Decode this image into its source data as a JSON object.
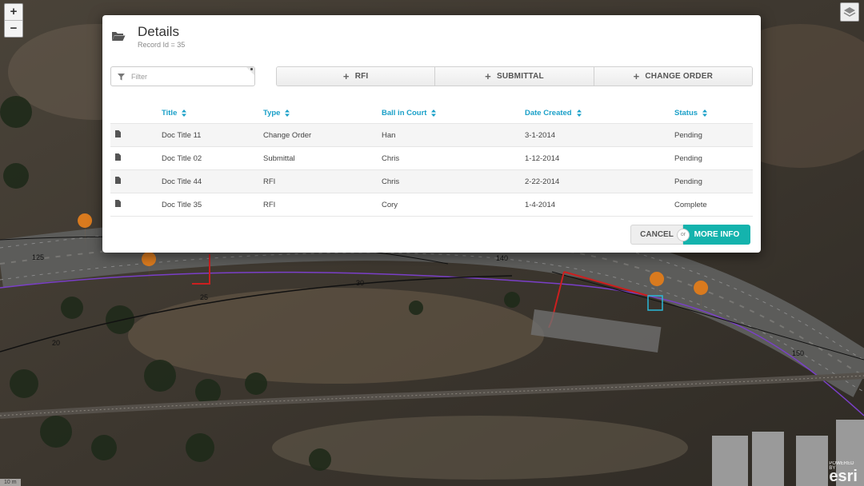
{
  "map": {
    "zoom_in": "+",
    "zoom_out": "−",
    "brand": "esri",
    "brand_small": "POWERED BY",
    "scale": "10 m"
  },
  "modal": {
    "title": "Details",
    "subtitle": "Record Id = 35",
    "filter_placeholder": "Filter",
    "actions": [
      {
        "label": "RFI",
        "icon": "plus-icon"
      },
      {
        "label": "SUBMITTAL",
        "icon": "plus-icon"
      },
      {
        "label": "CHANGE ORDER",
        "icon": "plus-icon"
      }
    ],
    "columns": [
      "Title",
      "Type",
      "Ball in Court",
      "Date Created",
      "Status"
    ],
    "rows": [
      [
        "Doc Title 11",
        "Change Order",
        "Han",
        "3-1-2014",
        "Pending"
      ],
      [
        "Doc Title 02",
        "Submittal",
        "Chris",
        "1-12-2014",
        "Pending"
      ],
      [
        "Doc Title 44",
        "RFI",
        "Chris",
        "2-22-2014",
        "Pending"
      ],
      [
        "Doc Title 35",
        "RFI",
        "Cory",
        "1-4-2014",
        "Complete"
      ]
    ],
    "cancel_label": "CANCEL",
    "or_label": "or",
    "more_info_label": "MORE INFO"
  },
  "colors": {
    "accent": "#1ba0c8",
    "primary_button": "#14b3ad",
    "marker": "#d97a1e"
  }
}
